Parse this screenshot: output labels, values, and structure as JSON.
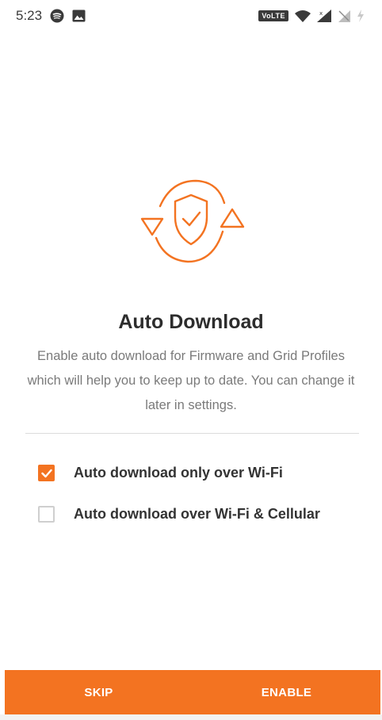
{
  "status_bar": {
    "time": "5:23",
    "left_icons": [
      "spotify-icon",
      "image-icon"
    ],
    "right_badge": "VoLTE",
    "right_icons": [
      "wifi-icon",
      "cellular-signal-icon",
      "no-sim-icon",
      "battery-charging-icon"
    ]
  },
  "hero": {
    "icon": "sync-shield-check-icon",
    "accent_color": "#f37321"
  },
  "title": "Auto Download",
  "description": "Enable auto download for Firmware and Grid Profiles which will help you to keep up to date. You can change it later in settings.",
  "options": [
    {
      "label": "Auto download only over Wi-Fi",
      "checked": true
    },
    {
      "label": "Auto download over Wi-Fi & Cellular",
      "checked": false
    }
  ],
  "actions": {
    "skip_label": "SKIP",
    "enable_label": "ENABLE",
    "bar_color": "#f37321"
  }
}
